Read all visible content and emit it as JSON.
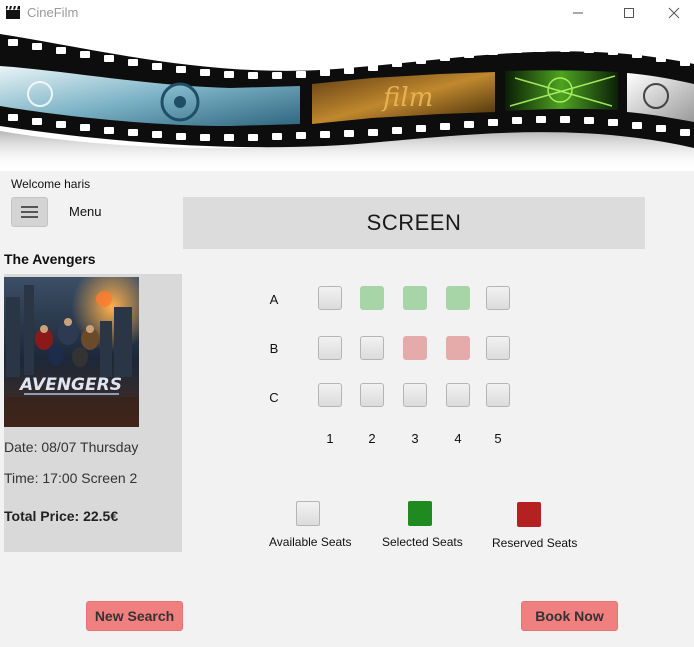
{
  "window": {
    "title": "CineFilm",
    "icon": "clapperboard-icon"
  },
  "banner": {
    "text": "film"
  },
  "sidebar": {
    "welcome": "Welcome haris",
    "menu_label": "Menu",
    "menu_icon": "hamburger-icon"
  },
  "movie": {
    "title": "The Avengers",
    "poster_title": "AVENGERS",
    "date": "Date: 08/07 Thursday",
    "time": "Time: 17:00 Screen 2",
    "total_price": "Total Price: 22.5€"
  },
  "screen": {
    "label": "SCREEN"
  },
  "seating": {
    "rows": [
      {
        "label": "A",
        "seats": [
          "available",
          "selected",
          "selected",
          "selected",
          "available"
        ]
      },
      {
        "label": "B",
        "seats": [
          "available",
          "available",
          "reserved",
          "reserved",
          "available"
        ]
      },
      {
        "label": "C",
        "seats": [
          "available",
          "available",
          "available",
          "available",
          "available"
        ]
      }
    ],
    "columns": [
      "1",
      "2",
      "3",
      "4",
      "5"
    ]
  },
  "legend": {
    "available": "Available Seats",
    "selected": "Selected Seats",
    "reserved": "Reserved Seats"
  },
  "actions": {
    "new_search": "New Search",
    "book_now": "Book Now"
  },
  "colors": {
    "selected_seat": "#a8d5a8",
    "reserved_seat": "#e5aaaa",
    "legend_selected": "#1f8a1f",
    "legend_reserved": "#b52121",
    "button": "#f08080"
  }
}
